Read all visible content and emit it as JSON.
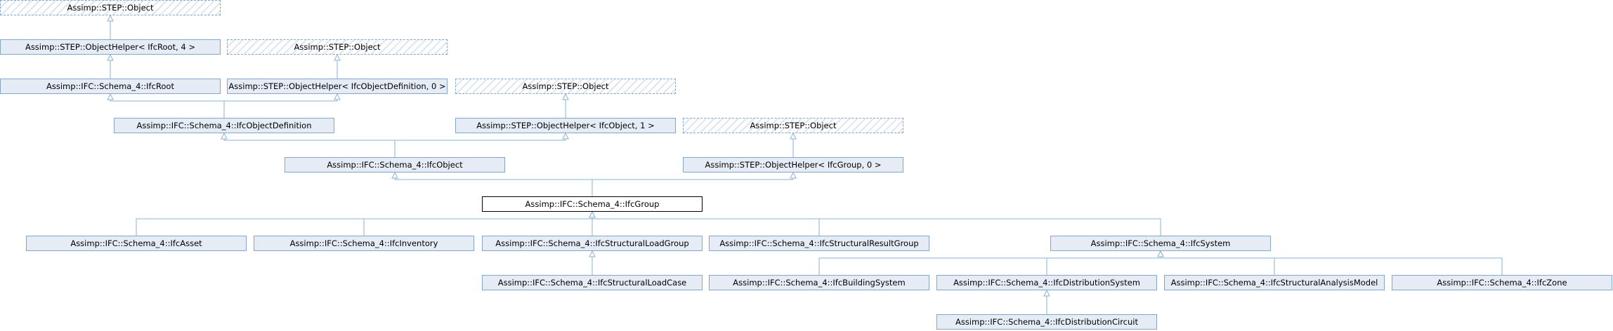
{
  "diagram": {
    "nodes": [
      {
        "id": "so1",
        "label": "Assimp::STEP::Object",
        "style": "dashed"
      },
      {
        "id": "ohroot",
        "label": "Assimp::STEP::ObjectHelper< IfcRoot, 4 >",
        "style": "normal"
      },
      {
        "id": "so2",
        "label": "Assimp::STEP::Object",
        "style": "dashed"
      },
      {
        "id": "root",
        "label": "Assimp::IFC::Schema_4::IfcRoot",
        "style": "normal"
      },
      {
        "id": "ohobjdef",
        "label": "Assimp::STEP::ObjectHelper< IfcObjectDefinition, 0 >",
        "style": "normal"
      },
      {
        "id": "so3",
        "label": "Assimp::STEP::Object",
        "style": "dashed"
      },
      {
        "id": "objdef",
        "label": "Assimp::IFC::Schema_4::IfcObjectDefinition",
        "style": "normal"
      },
      {
        "id": "ohobj",
        "label": "Assimp::STEP::ObjectHelper< IfcObject, 1 >",
        "style": "normal"
      },
      {
        "id": "so4",
        "label": "Assimp::STEP::Object",
        "style": "dashed"
      },
      {
        "id": "obj",
        "label": "Assimp::IFC::Schema_4::IfcObject",
        "style": "normal"
      },
      {
        "id": "ohgroup",
        "label": "Assimp::STEP::ObjectHelper< IfcGroup, 0 >",
        "style": "normal"
      },
      {
        "id": "group",
        "label": "Assimp::IFC::Schema_4::IfcGroup",
        "style": "current"
      },
      {
        "id": "asset",
        "label": "Assimp::IFC::Schema_4::IfcAsset",
        "style": "normal"
      },
      {
        "id": "inventory",
        "label": "Assimp::IFC::Schema_4::IfcInventory",
        "style": "normal"
      },
      {
        "id": "slg",
        "label": "Assimp::IFC::Schema_4::IfcStructuralLoadGroup",
        "style": "normal"
      },
      {
        "id": "srg",
        "label": "Assimp::IFC::Schema_4::IfcStructuralResultGroup",
        "style": "normal"
      },
      {
        "id": "system",
        "label": "Assimp::IFC::Schema_4::IfcSystem",
        "style": "normal"
      },
      {
        "id": "slc",
        "label": "Assimp::IFC::Schema_4::IfcStructuralLoadCase",
        "style": "normal"
      },
      {
        "id": "bsys",
        "label": "Assimp::IFC::Schema_4::IfcBuildingSystem",
        "style": "normal"
      },
      {
        "id": "dsys",
        "label": "Assimp::IFC::Schema_4::IfcDistributionSystem",
        "style": "normal"
      },
      {
        "id": "sam",
        "label": "Assimp::IFC::Schema_4::IfcStructuralAnalysisModel",
        "style": "normal"
      },
      {
        "id": "zone",
        "label": "Assimp::IFC::Schema_4::IfcZone",
        "style": "normal"
      },
      {
        "id": "dcirc",
        "label": "Assimp::IFC::Schema_4::IfcDistributionCircuit",
        "style": "normal"
      }
    ],
    "edges": [
      {
        "from": "ohroot",
        "to": "so1"
      },
      {
        "from": "root",
        "to": "ohroot"
      },
      {
        "from": "ohobjdef",
        "to": "so2"
      },
      {
        "from": "objdef",
        "to": "root"
      },
      {
        "from": "objdef",
        "to": "ohobjdef"
      },
      {
        "from": "ohobj",
        "to": "so3"
      },
      {
        "from": "obj",
        "to": "objdef"
      },
      {
        "from": "obj",
        "to": "ohobj"
      },
      {
        "from": "ohgroup",
        "to": "so4"
      },
      {
        "from": "group",
        "to": "obj"
      },
      {
        "from": "group",
        "to": "ohgroup"
      },
      {
        "from": "asset",
        "to": "group"
      },
      {
        "from": "inventory",
        "to": "group"
      },
      {
        "from": "slg",
        "to": "group"
      },
      {
        "from": "srg",
        "to": "group"
      },
      {
        "from": "system",
        "to": "group"
      },
      {
        "from": "slc",
        "to": "slg"
      },
      {
        "from": "bsys",
        "to": "system"
      },
      {
        "from": "dsys",
        "to": "system"
      },
      {
        "from": "sam",
        "to": "system"
      },
      {
        "from": "zone",
        "to": "system"
      },
      {
        "from": "dcirc",
        "to": "dsys"
      }
    ],
    "colors": {
      "edge": "#8bb2d6",
      "node_fill": "#e6ecf6",
      "node_border": "#84a7c9",
      "current_border": "#000000"
    }
  }
}
